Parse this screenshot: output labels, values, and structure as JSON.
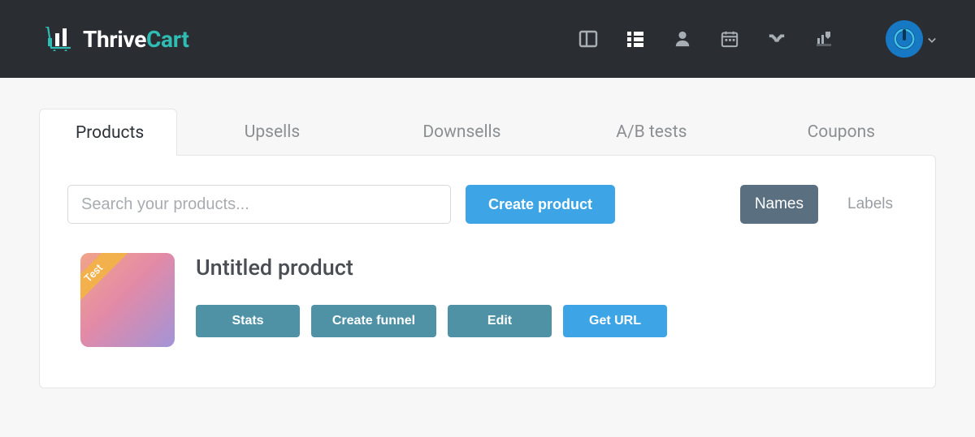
{
  "brand": {
    "name_a": "Thrive",
    "name_b": "Cart"
  },
  "tabs": {
    "products": "Products",
    "upsells": "Upsells",
    "downsells": "Downsells",
    "abtests": "A/B tests",
    "coupons": "Coupons"
  },
  "toolbar": {
    "search_placeholder": "Search your products...",
    "create_label": "Create product",
    "view_names": "Names",
    "view_labels": "Labels"
  },
  "product": {
    "title": "Untitled product",
    "ribbon": "Test",
    "actions": {
      "stats": "Stats",
      "create_funnel": "Create funnel",
      "edit": "Edit",
      "get_url": "Get URL"
    }
  }
}
